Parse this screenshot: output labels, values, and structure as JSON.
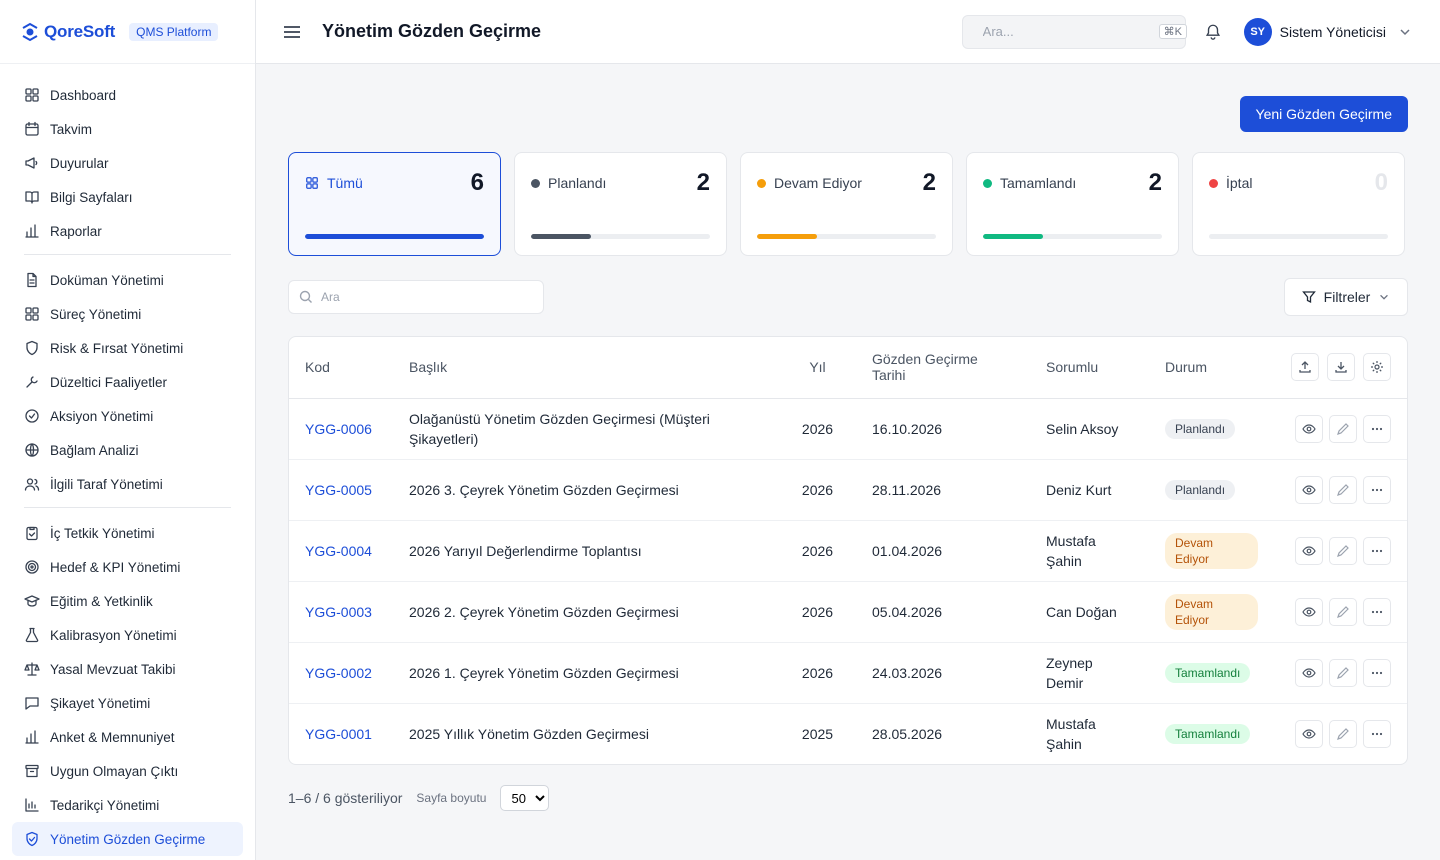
{
  "brand": {
    "name": "QoreSoft",
    "platform": "QMS Platform"
  },
  "sidebar": {
    "groups": [
      {
        "items": [
          {
            "label": "Dashboard",
            "icon": "dashboard-icon"
          },
          {
            "label": "Takvim",
            "icon": "calendar-icon"
          },
          {
            "label": "Duyurular",
            "icon": "megaphone-icon"
          },
          {
            "label": "Bilgi Sayfaları",
            "icon": "book-icon"
          },
          {
            "label": "Raporlar",
            "icon": "bar-chart-icon"
          }
        ]
      },
      {
        "items": [
          {
            "label": "Doküman Yönetimi",
            "icon": "document-icon"
          },
          {
            "label": "Süreç Yönetimi",
            "icon": "process-icon"
          },
          {
            "label": "Risk & Fırsat Yönetimi",
            "icon": "shield-icon"
          },
          {
            "label": "Düzeltici Faaliyetler",
            "icon": "wrench-icon"
          },
          {
            "label": "Aksiyon Yönetimi",
            "icon": "check-circle-icon"
          },
          {
            "label": "Bağlam Analizi",
            "icon": "globe-icon"
          },
          {
            "label": "İlgili Taraf Yönetimi",
            "icon": "users-icon"
          }
        ]
      },
      {
        "items": [
          {
            "label": "İç Tetkik Yönetimi",
            "icon": "clipboard-icon"
          },
          {
            "label": "Hedef & KPI Yönetimi",
            "icon": "target-icon"
          },
          {
            "label": "Eğitim & Yetkinlik",
            "icon": "graduation-cap-icon"
          },
          {
            "label": "Kalibrasyon Yönetimi",
            "icon": "flask-icon"
          },
          {
            "label": "Yasal Mevzuat Takibi",
            "icon": "scale-icon"
          },
          {
            "label": "Şikayet Yönetimi",
            "icon": "message-icon"
          },
          {
            "label": "Anket & Memnuniyet",
            "icon": "bar-chart-icon"
          },
          {
            "label": "Uygun Olmayan Çıktı",
            "icon": "archive-icon"
          },
          {
            "label": "Tedarikçi Yönetimi",
            "icon": "chart-icon"
          },
          {
            "label": "Yönetim Gözden Geçirme",
            "icon": "shield-check-icon",
            "active": true
          }
        ]
      }
    ]
  },
  "header": {
    "title": "Yönetim Gözden Geçirme",
    "search_placeholder": "Ara...",
    "search_shortcut": "⌘K",
    "user_initials": "SY",
    "user_name": "Sistem Yöneticisi"
  },
  "actions": {
    "new_button": "Yeni Gözden Geçirme"
  },
  "stats": [
    {
      "label": "Tümü",
      "count": "6",
      "fill": 1.0,
      "color": "#1d4ed8",
      "selected": true
    },
    {
      "label": "Planlandı",
      "count": "2",
      "fill": 0.333,
      "color": "#4b5563"
    },
    {
      "label": "Devam Ediyor",
      "count": "2",
      "fill": 0.333,
      "color": "#f59e0b"
    },
    {
      "label": "Tamamlandı",
      "count": "2",
      "fill": 0.333,
      "color": "#10b981"
    },
    {
      "label": "İptal",
      "count": "0",
      "fill": 0,
      "color": "#ef4444"
    }
  ],
  "list": {
    "search_placeholder": "Ara",
    "filter_label": "Filtreler"
  },
  "table": {
    "headers": {
      "code": "Kod",
      "title": "Başlık",
      "year": "Yıl",
      "date": "Gözden Geçirme Tarihi",
      "responsible": "Sorumlu",
      "status": "Durum"
    },
    "rows": [
      {
        "code": "YGG-0006",
        "title": "Olağanüstü Yönetim Gözden Geçirmesi (Müşteri Şikayetleri)",
        "year": "2026",
        "date": "16.10.2026",
        "responsible": "Selin Aksoy",
        "status": "Planlandı",
        "status_type": "plan"
      },
      {
        "code": "YGG-0005",
        "title": "2026 3. Çeyrek Yönetim Gözden Geçirmesi",
        "year": "2026",
        "date": "28.11.2026",
        "responsible": "Deniz Kurt",
        "status": "Planlandı",
        "status_type": "plan"
      },
      {
        "code": "YGG-0004",
        "title": "2026 Yarıyıl Değerlendirme Toplantısı",
        "year": "2026",
        "date": "01.04.2026",
        "responsible": "Mustafa Şahin",
        "status": "Devam Ediyor",
        "status_type": "prog"
      },
      {
        "code": "YGG-0003",
        "title": "2026 2. Çeyrek Yönetim Gözden Geçirmesi",
        "year": "2026",
        "date": "05.04.2026",
        "responsible": "Can Doğan",
        "status": "Devam Ediyor",
        "status_type": "prog"
      },
      {
        "code": "YGG-0002",
        "title": "2026 1. Çeyrek Yönetim Gözden Geçirmesi",
        "year": "2026",
        "date": "24.03.2026",
        "responsible": "Zeynep Demir",
        "status": "Tamamlandı",
        "status_type": "done"
      },
      {
        "code": "YGG-0001",
        "title": "2025 Yıllık Yönetim Gözden Geçirmesi",
        "year": "2025",
        "date": "28.05.2026",
        "responsible": "Mustafa Şahin",
        "status": "Tamamlandı",
        "status_type": "done"
      }
    ]
  },
  "pagination": {
    "info": "1–6 / 6 gösteriliyor",
    "page_size_label": "Sayfa boyutu",
    "page_size": "50"
  }
}
